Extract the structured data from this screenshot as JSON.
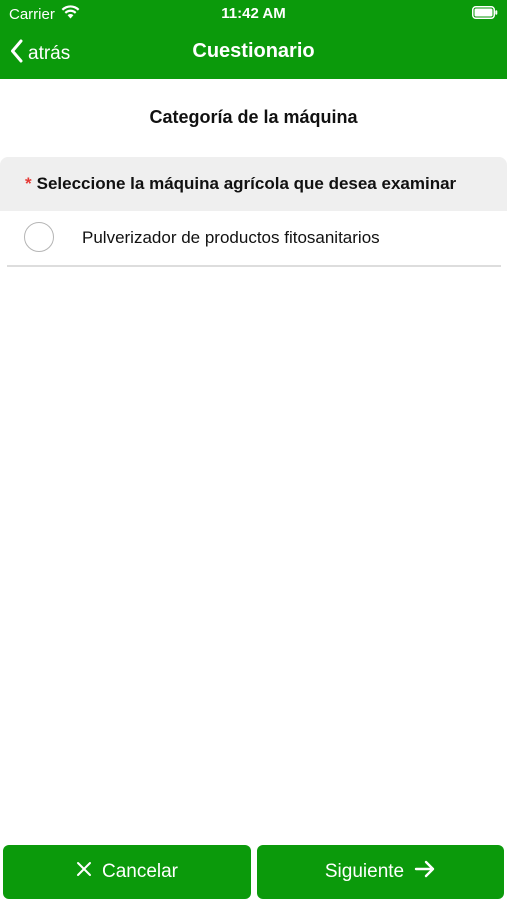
{
  "status_bar": {
    "carrier": "Carrier",
    "time": "11:42 AM"
  },
  "navbar": {
    "back_label": "atrás",
    "title": "Cuestionario"
  },
  "section": {
    "title": "Categoría de la máquina"
  },
  "question": {
    "required_mark": "*",
    "text": "Seleccione la máquina agrícola que desea examinar",
    "options": [
      {
        "label": "Pulverizador de productos fitosanitarios",
        "selected": false
      }
    ]
  },
  "footer": {
    "cancel_label": "Cancelar",
    "next_label": "Siguiente"
  },
  "colors": {
    "brand_green": "#0b9a0b",
    "required_red": "#e53935",
    "question_bg": "#efefef"
  },
  "icons": {
    "wifi": "wifi-icon",
    "battery": "battery-icon",
    "back": "chevron-left-icon",
    "cancel": "close-icon",
    "next": "arrow-right-icon"
  }
}
